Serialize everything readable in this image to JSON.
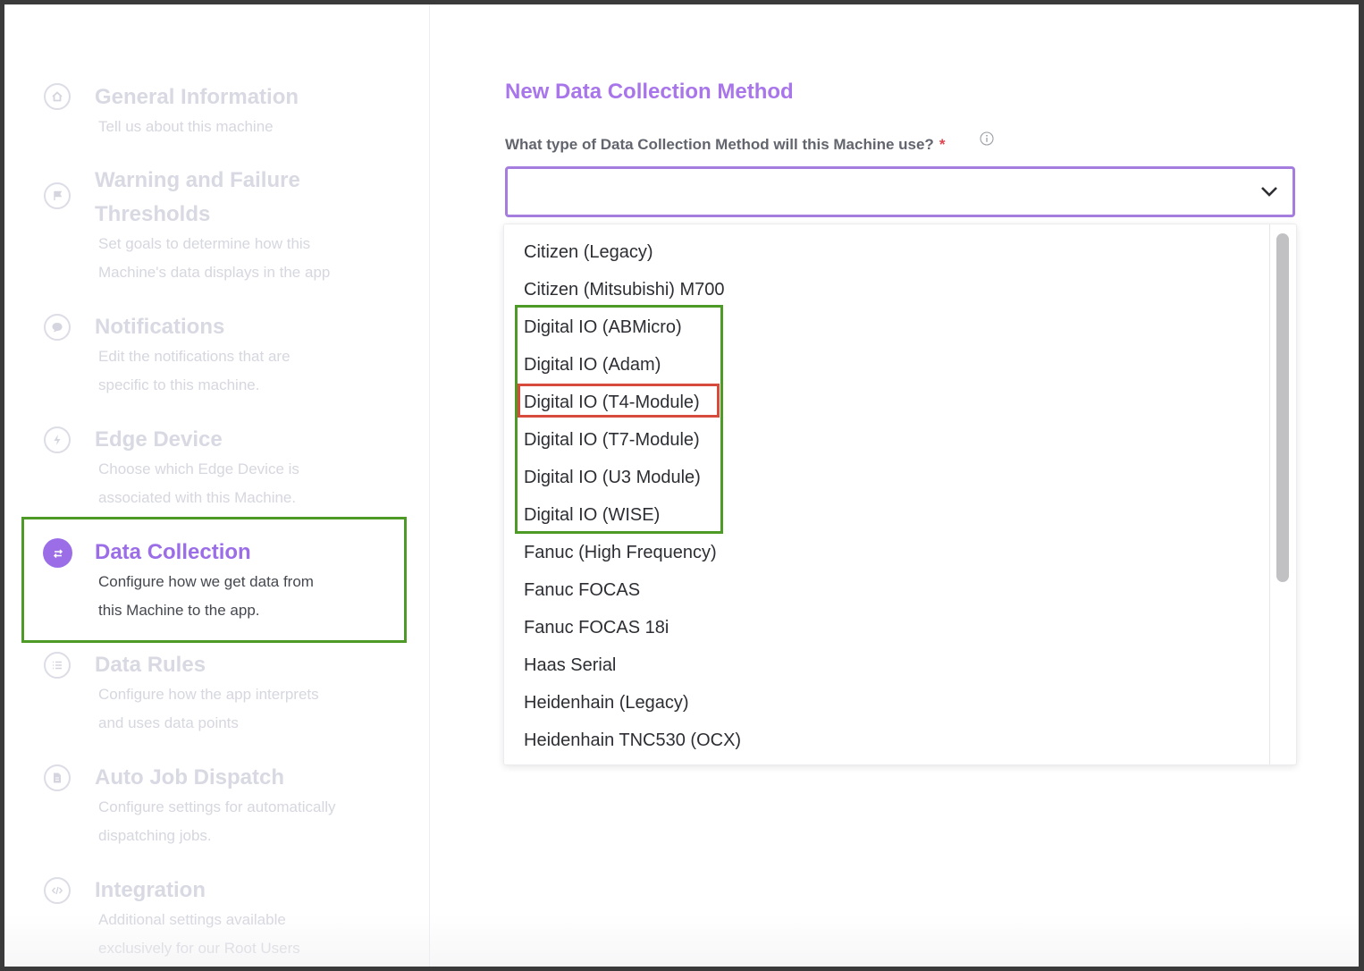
{
  "sidebar": {
    "steps": [
      {
        "title": "General Information",
        "desc1": "Tell us about this machine",
        "desc2": "",
        "icon": "home-icon"
      },
      {
        "title": "Warning and Failure",
        "title2": "Thresholds",
        "desc1": "Set goals to determine how this",
        "desc2": "Machine's data displays in the app",
        "icon": "flag-icon"
      },
      {
        "title": "Notifications",
        "desc1": "Edit the notifications that are",
        "desc2": "specific to this machine.",
        "icon": "chat-bubble-icon"
      },
      {
        "title": "Edge Device",
        "desc1": "Choose which Edge Device is",
        "desc2": "associated with this Machine.",
        "icon": "bolt-icon"
      },
      {
        "title": "Data Collection",
        "desc1": "Configure how we get data from",
        "desc2": "this Machine to the app.",
        "icon": "transfer-arrows-icon",
        "active": true
      },
      {
        "title": "Data Rules",
        "desc1": "Configure how the app interprets",
        "desc2": "and uses data points",
        "icon": "list-icon"
      },
      {
        "title": "Auto Job Dispatch",
        "desc1": "Configure settings for automatically",
        "desc2": "dispatching jobs.",
        "icon": "document-icon"
      },
      {
        "title": "Integration",
        "desc1": "Additional settings available",
        "desc2": "exclusively for our Root Users",
        "icon": "code-icon"
      }
    ]
  },
  "main": {
    "title": "New Data Collection Method",
    "question": "What type of Data Collection Method will this Machine use?",
    "required_mark": "*",
    "select_value": "",
    "options": [
      "Citizen (Legacy)",
      "Citizen (Mitsubishi) M700",
      "Digital IO (ABMicro)",
      "Digital IO (Adam)",
      "Digital IO (T4-Module)",
      "Digital IO (T7-Module)",
      "Digital IO (U3 Module)",
      "Digital IO (WISE)",
      "Fanuc (High Frequency)",
      "Fanuc FOCAS",
      "Fanuc FOCAS 18i",
      "Haas Serial",
      "Heidenhain (Legacy)",
      "Heidenhain TNC530 (OCX)"
    ]
  },
  "colors": {
    "accent": "#a876ea",
    "inactive": "#d8d9e2",
    "highlight_green": "#4e9a26",
    "highlight_red": "#d64b3c"
  }
}
